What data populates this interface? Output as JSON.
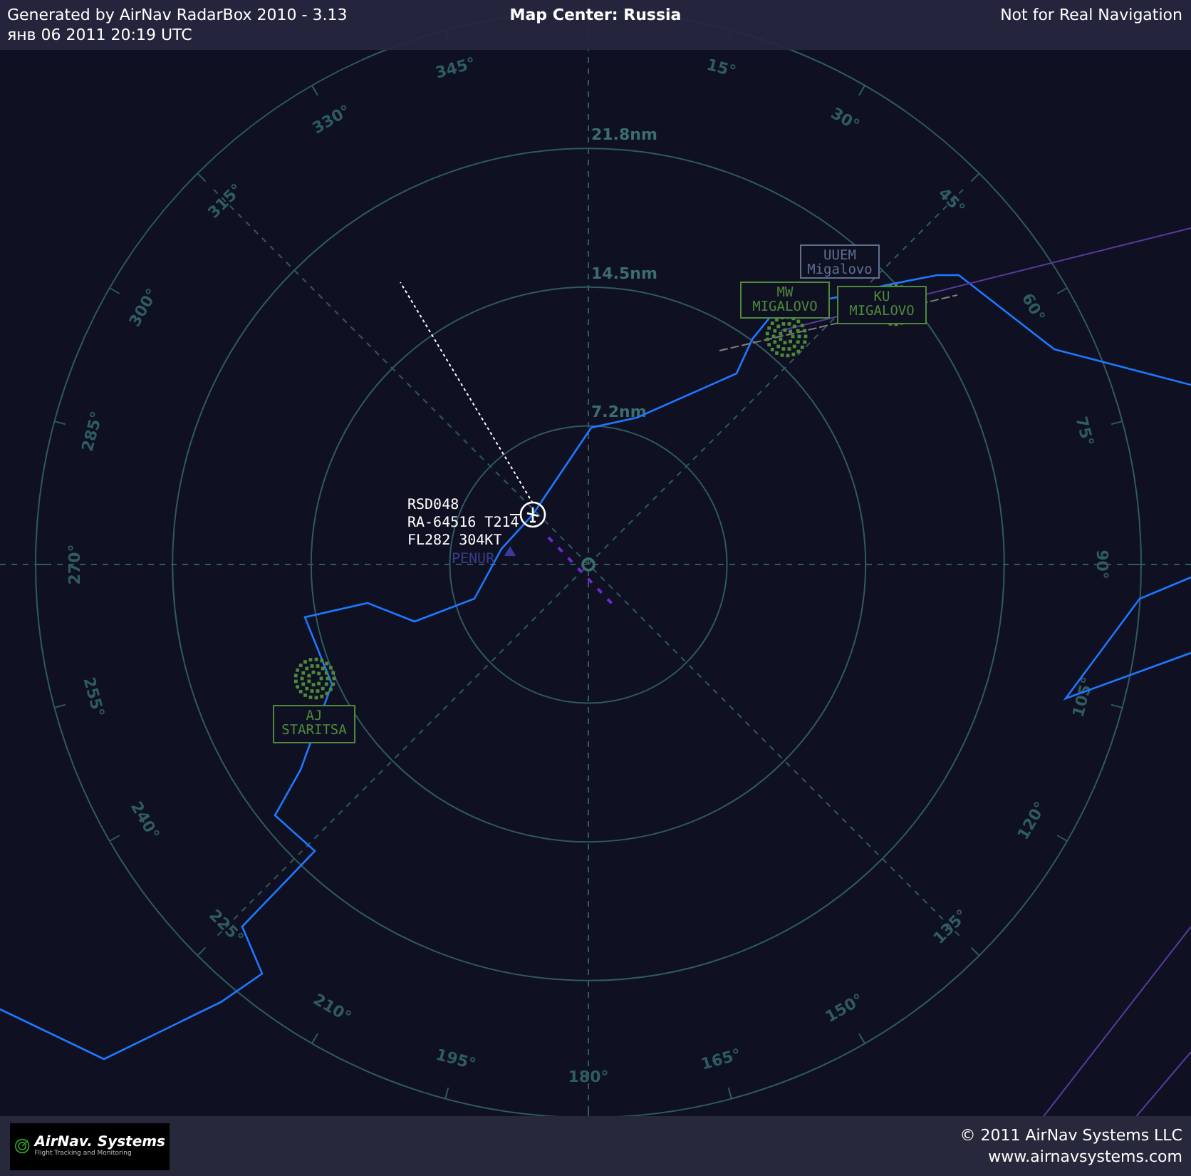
{
  "header": {
    "generator": "Generated by AirNav RadarBox 2010 - 3.13",
    "timestamp": "янв 06 2011 20:19 UTC",
    "title": "Map Center: Russia",
    "notice": "Not for Real Navigation"
  },
  "radar": {
    "range_rings": [
      {
        "label": "21.8nm"
      },
      {
        "label": "14.5nm"
      },
      {
        "label": "7.2nm"
      }
    ],
    "bearings": [
      {
        "label": "15°"
      },
      {
        "label": "30°"
      },
      {
        "label": "45°"
      },
      {
        "label": "60°"
      },
      {
        "label": "75°"
      },
      {
        "label": "90°"
      },
      {
        "label": "105°"
      },
      {
        "label": "120°"
      },
      {
        "label": "135°"
      },
      {
        "label": "150°"
      },
      {
        "label": "165°"
      },
      {
        "label": "180°"
      },
      {
        "label": "195°"
      },
      {
        "label": "210°"
      },
      {
        "label": "225°"
      },
      {
        "label": "240°"
      },
      {
        "label": "255°"
      },
      {
        "label": "270°"
      },
      {
        "label": "285°"
      },
      {
        "label": "300°"
      },
      {
        "label": "315°"
      },
      {
        "label": "330°"
      },
      {
        "label": "345°"
      }
    ]
  },
  "aircraft": [
    {
      "lines": [
        "RSD048",
        "RA-64516 T214",
        "FL282 304KT"
      ]
    }
  ],
  "waypoints": [
    {
      "name": "PENUR"
    }
  ],
  "stations": [
    {
      "kind": "vor",
      "lines": [
        "AJ",
        "STARITSA"
      ]
    },
    {
      "kind": "vor",
      "lines": [
        "MW",
        "MIGALOVO"
      ]
    },
    {
      "kind": "airport",
      "lines": [
        "UUEM",
        "Migalovo"
      ]
    },
    {
      "kind": "vor",
      "lines": [
        "KU",
        "MIGALOVO"
      ]
    }
  ],
  "footer": {
    "logo": "AirNav. Systems",
    "tagline": "Flight Tracking and Monitoring",
    "copyright": "© 2011 AirNav Systems LLC",
    "website": "www.airnavsystems.com"
  }
}
